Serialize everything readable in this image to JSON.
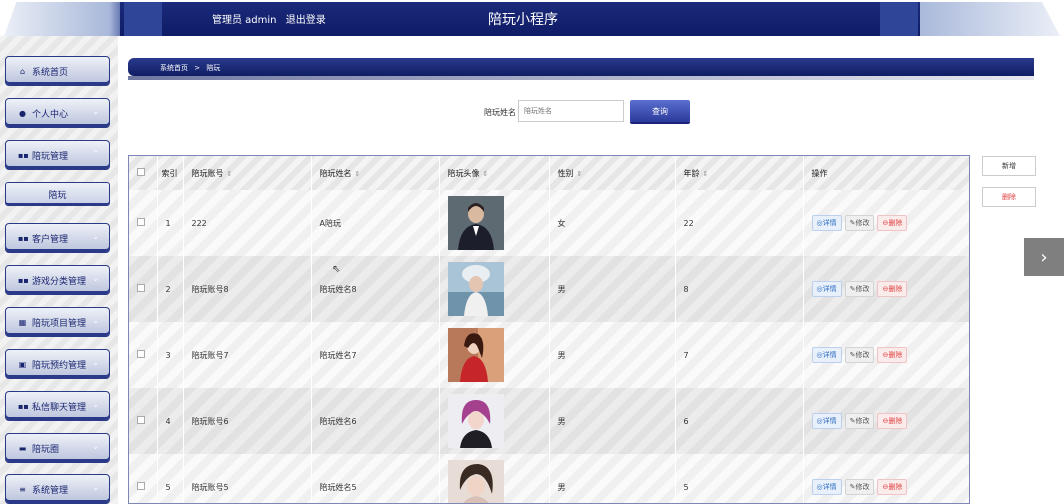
{
  "header": {
    "admin_label": "管理员 admin",
    "logout_label": "退出登录",
    "title": "陪玩小程序"
  },
  "sidebar": {
    "items": [
      {
        "label": "系统首页",
        "icon": "home-icon"
      },
      {
        "label": "个人中心",
        "icon": "user-icon"
      },
      {
        "label": "陪玩管理",
        "icon": "grid-icon",
        "expanded": true
      },
      {
        "label": "陪玩",
        "sub": true
      },
      {
        "label": "客户管理",
        "icon": "grid-icon"
      },
      {
        "label": "游戏分类管理",
        "icon": "grid-icon"
      },
      {
        "label": "陪玩项目管理",
        "icon": "table-icon"
      },
      {
        "label": "陪玩预约管理",
        "icon": "doc-icon"
      },
      {
        "label": "私信聊天管理",
        "icon": "grid-icon"
      },
      {
        "label": "陪玩圈",
        "icon": "card-icon"
      },
      {
        "label": "系统管理",
        "icon": "list-icon"
      }
    ]
  },
  "breadcrumb": {
    "home": "系统首页",
    "sep": ">",
    "current": "陪玩"
  },
  "search": {
    "label": "陪玩姓名",
    "placeholder": "陪玩姓名",
    "button": "查询"
  },
  "actions": {
    "add": "新增",
    "delete": "删除"
  },
  "table": {
    "headers": [
      "索引",
      "陪玩账号",
      "陪玩姓名",
      "陪玩头像",
      "性别",
      "年龄",
      "操作"
    ],
    "ops": {
      "detail": "◎详情",
      "edit": "✎修改",
      "delete": "⊖删除"
    },
    "rows": [
      {
        "idx": "1",
        "account": "222",
        "name": "A陪玩",
        "gender": "女",
        "age": "22"
      },
      {
        "idx": "2",
        "account": "陪玩账号8",
        "name": "陪玩姓名8",
        "gender": "男",
        "age": "8"
      },
      {
        "idx": "3",
        "account": "陪玩账号7",
        "name": "陪玩姓名7",
        "gender": "男",
        "age": "7"
      },
      {
        "idx": "4",
        "account": "陪玩账号6",
        "name": "陪玩姓名6",
        "gender": "男",
        "age": "6"
      },
      {
        "idx": "5",
        "account": "陪玩账号5",
        "name": "陪玩姓名5",
        "gender": "男",
        "age": "5"
      }
    ]
  }
}
